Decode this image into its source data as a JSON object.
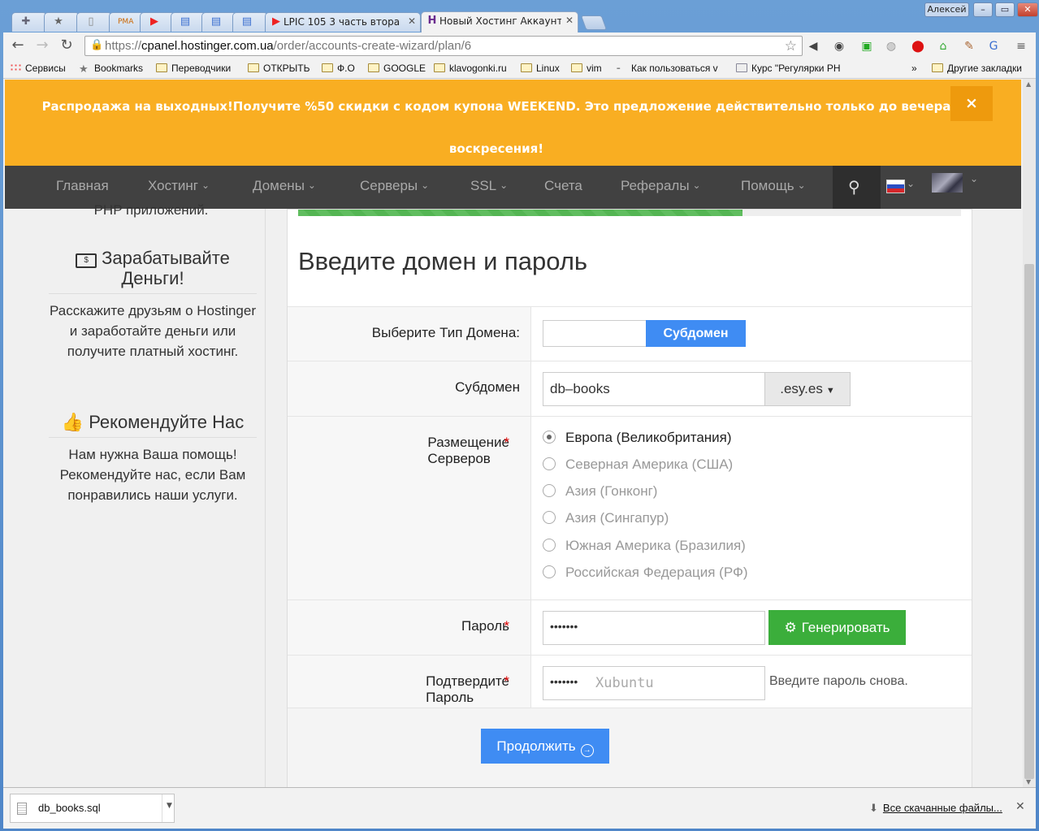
{
  "browser": {
    "user": "Алексей",
    "tabs": [
      {
        "label": "",
        "icon": "puzzle"
      },
      {
        "label": "",
        "icon": "star"
      },
      {
        "label": "",
        "icon": "page"
      },
      {
        "label": "",
        "icon": "pma"
      },
      {
        "label": "",
        "icon": "youtube"
      },
      {
        "label": "",
        "icon": "doc"
      },
      {
        "label": "",
        "icon": "doc"
      },
      {
        "label": "",
        "icon": "doc"
      },
      {
        "label": "LPIC 105 3 часть втора",
        "icon": "youtube"
      },
      {
        "label": "Новый Хостинг Аккаунт",
        "icon": "hostinger"
      }
    ],
    "url_prefix": "https://",
    "url_host": "cpanel.hostinger.com.ua",
    "url_path": "/order/accounts-create-wizard/plan/6",
    "bookmarks": [
      "Сервисы",
      "Bookmarks",
      "Переводчики",
      "ОТКРЫТЬ",
      "Ф.О",
      "GOOGLE",
      "klavogonki.ru",
      "Linux",
      "vim",
      "Как пользоваться v",
      "Курс \"Регулярки PH",
      "»",
      "Другие закладки"
    ]
  },
  "promo": {
    "text": "Распродажа на выходных!Получите %50 скидки с кодом купона WEEKEND. Это предложение действительно только до вечера воскресения!",
    "close": "×"
  },
  "nav": {
    "items": [
      "Главная",
      "Хостинг",
      "Домены",
      "Серверы",
      "SSL",
      "Счета",
      "Рефералы",
      "Помощь"
    ]
  },
  "sidebar": {
    "cut_text": "PHP приложений.",
    "earn_title": "Зарабатывайте Деньги!",
    "earn_text": "Расскажите друзьям о Hostinger и заработайте деньги или получите платный хостинг.",
    "recommend_title": "Рекомендуйте Нас",
    "recommend_text": "Нам нужна Ваша помощь! Рекомендуйте нас, если Вам понравились наши услуги."
  },
  "form": {
    "progress": 0.67,
    "title": "Введите домен и пароль",
    "domain_type_label": "Выберите Тип Домена:",
    "domain_type_value": "Субдомен",
    "subdomain_label": "Субдомен",
    "subdomain_value": "db–books",
    "subdomain_suffix": ".esy.es",
    "server_label": "Размещение Серверов",
    "server_options": [
      {
        "label": "Европа (Великобритания)",
        "checked": true
      },
      {
        "label": "Северная Америка (США)",
        "checked": false
      },
      {
        "label": "Азия (Гонконг)",
        "checked": false
      },
      {
        "label": "Азия (Сингапур)",
        "checked": false
      },
      {
        "label": "Южная Америка (Бразилия)",
        "checked": false
      },
      {
        "label": "Российская Федерация (РФ)",
        "checked": false
      }
    ],
    "password_label": "Пароль",
    "password_value": "•••••••",
    "generate_label": "Генерировать",
    "confirm_label": "Подтвердите Пароль",
    "confirm_value": "•••••••",
    "confirm_hint_overlay": "Xubuntu",
    "confirm_help": "Введите пароль снова.",
    "required_mark": "*",
    "submit_label": "Продолжить"
  },
  "downloads": {
    "file": "db_books.sql",
    "all": "Все скачанные файлы..."
  },
  "colors": {
    "promo": "#f9ae22",
    "nav": "#414141",
    "primary": "#3f8cf3",
    "success": "#3bae3b"
  }
}
